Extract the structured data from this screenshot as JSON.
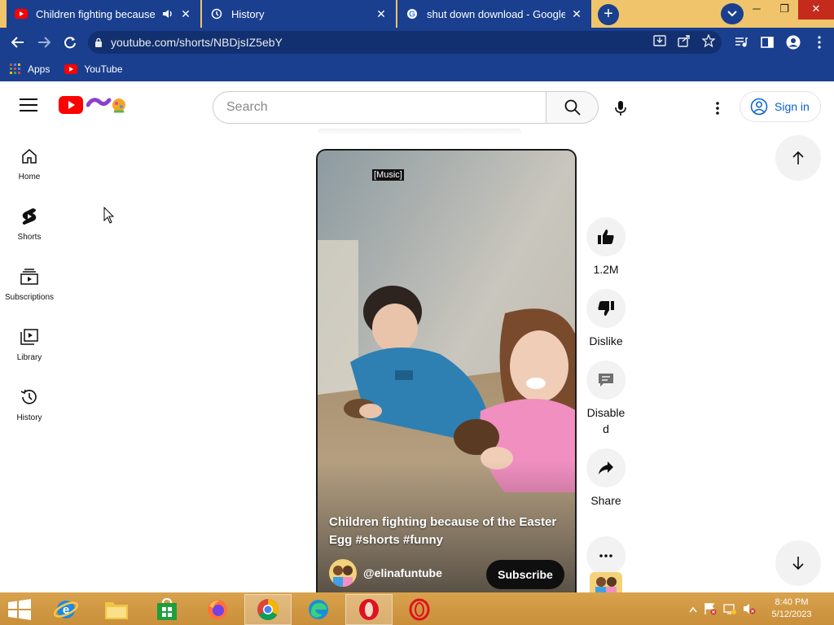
{
  "browser": {
    "tabs": [
      {
        "title": "Children fighting because of",
        "favicon": "youtube-icon",
        "audio": "speaker-icon",
        "state": "active-muted"
      },
      {
        "title": "History",
        "favicon": "history-icon",
        "state": "inactive"
      },
      {
        "title": "shut down download - Google Se",
        "favicon": "google-icon",
        "state": "inactive"
      }
    ],
    "new_tab_symbol": "+",
    "url": "youtube.com/shorts/NBDjsIZ5ebY",
    "bookmarks": [
      {
        "label": "Apps",
        "icon": "apps-grid-icon"
      },
      {
        "label": "YouTube",
        "icon": "youtube-icon"
      }
    ]
  },
  "youtube": {
    "search_placeholder": "Search",
    "sign_in": "Sign in",
    "guide": [
      {
        "label": "Home",
        "icon": "home-icon"
      },
      {
        "label": "Shorts",
        "icon": "shorts-icon"
      },
      {
        "label": "Subscriptions",
        "icon": "subscriptions-icon"
      },
      {
        "label": "Library",
        "icon": "library-icon"
      },
      {
        "label": "History",
        "icon": "history-icon"
      }
    ],
    "short": {
      "music_tag": "[Music]",
      "caption": "Children fighting because of the Easter Egg #shorts #funny",
      "channel": "@elinafuntube",
      "subscribe": "Subscribe"
    },
    "actions": {
      "like": "1.2M",
      "dislike": "Dislike",
      "comments": "Disabled",
      "share": "Share"
    }
  },
  "taskbar": {
    "time": "8:40 PM",
    "date": "5/12/2023"
  },
  "colors": {
    "chrome_frame": "#1a3f8f",
    "tabstrip": "#f0c46a",
    "youtube_red": "#ff0000",
    "link_blue": "#065fd4",
    "taskbar": "#d9a24c"
  }
}
